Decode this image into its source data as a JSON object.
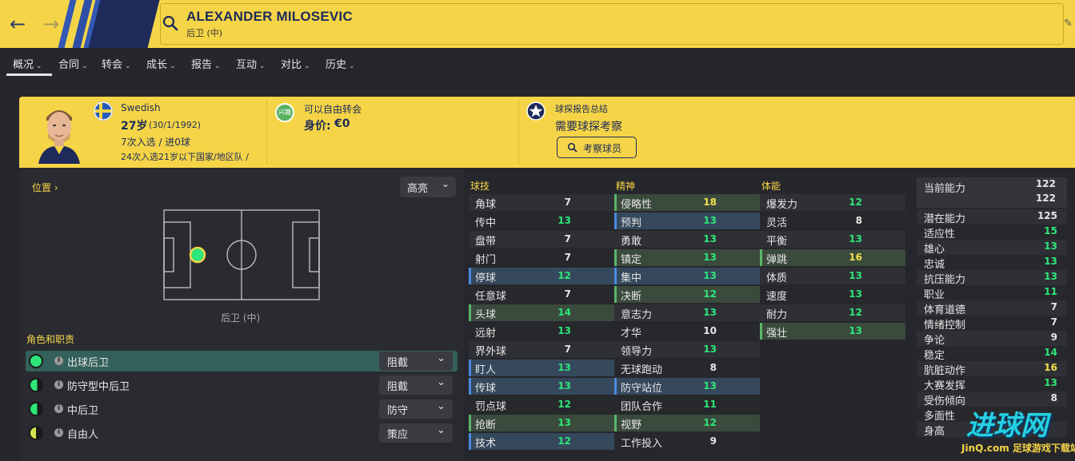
{
  "header": {
    "player_name": "ALEXANDER MILOSEVIC",
    "position": "后卫 (中)",
    "back_icon": "back-arrow-icon",
    "forward_icon": "forward-arrow-icon",
    "search_icon": "search-icon",
    "edit_icon": "pencil-icon"
  },
  "tabs": [
    {
      "label": "概况"
    },
    {
      "label": "合同"
    },
    {
      "label": "转会"
    },
    {
      "label": "成长"
    },
    {
      "label": "报告"
    },
    {
      "label": "互动"
    },
    {
      "label": "对比"
    },
    {
      "label": "历史"
    }
  ],
  "banner": {
    "nationality": "Swedish",
    "age": "27岁",
    "dob": "(30/1/1992)",
    "caps": "7次入选 / 进0球",
    "youth_caps": "24次入选21岁以下国家/地区队 /",
    "transfer_status": "可以自由转会",
    "interest_badge": "兴趣",
    "value_label": "身价:",
    "value": "€0",
    "scout_summary_title": "球探报告总结",
    "scout_summary": "需要球探考察",
    "scout_button": "考察球员"
  },
  "position_panel": {
    "title": "位置",
    "highlight_select": "高亮",
    "position_label": "后卫 (中)",
    "roles_title": "角色和职责",
    "roles": [
      {
        "name": "出球后卫",
        "duty": "阻截"
      },
      {
        "name": "防守型中后卫",
        "duty": "阻截"
      },
      {
        "name": "中后卫",
        "duty": "防守"
      },
      {
        "name": "自由人",
        "duty": "策应"
      }
    ]
  },
  "technical": {
    "title": "球技",
    "rows": [
      {
        "name": "角球",
        "value": "7"
      },
      {
        "name": "传中",
        "value": "13"
      },
      {
        "name": "盘带",
        "value": "7"
      },
      {
        "name": "射门",
        "value": "7"
      },
      {
        "name": "停球",
        "value": "12"
      },
      {
        "name": "任意球",
        "value": "7"
      },
      {
        "name": "头球",
        "value": "14"
      },
      {
        "name": "远射",
        "value": "13"
      },
      {
        "name": "界外球",
        "value": "7"
      },
      {
        "name": "盯人",
        "value": "13"
      },
      {
        "name": "传球",
        "value": "13"
      },
      {
        "name": "罚点球",
        "value": "12"
      },
      {
        "name": "抢断",
        "value": "13"
      },
      {
        "name": "技术",
        "value": "12"
      }
    ]
  },
  "mental": {
    "title": "精神",
    "rows": [
      {
        "name": "侵略性",
        "value": "18"
      },
      {
        "name": "预判",
        "value": "13"
      },
      {
        "name": "勇敢",
        "value": "13"
      },
      {
        "name": "镇定",
        "value": "13"
      },
      {
        "name": "集中",
        "value": "13"
      },
      {
        "name": "决断",
        "value": "12"
      },
      {
        "name": "意志力",
        "value": "13"
      },
      {
        "name": "才华",
        "value": "10"
      },
      {
        "name": "领导力",
        "value": "13"
      },
      {
        "name": "无球跑动",
        "value": "8"
      },
      {
        "name": "防守站位",
        "value": "13"
      },
      {
        "name": "团队合作",
        "value": "11"
      },
      {
        "name": "视野",
        "value": "12"
      },
      {
        "name": "工作投入",
        "value": "9"
      }
    ]
  },
  "physical": {
    "title": "体能",
    "rows": [
      {
        "name": "爆发力",
        "value": "12"
      },
      {
        "name": "灵活",
        "value": "8"
      },
      {
        "name": "平衡",
        "value": "13"
      },
      {
        "name": "弹跳",
        "value": "16"
      },
      {
        "name": "体质",
        "value": "13"
      },
      {
        "name": "速度",
        "value": "13"
      },
      {
        "name": "耐力",
        "value": "12"
      },
      {
        "name": "强壮",
        "value": "13"
      }
    ]
  },
  "hidden": {
    "ability_current_label": "当前能力",
    "ability_current_a": "122",
    "ability_current_b": "122",
    "rows": [
      {
        "name": "潜在能力",
        "value": "125"
      },
      {
        "name": "适应性",
        "value": "15"
      },
      {
        "name": "雄心",
        "value": "13"
      },
      {
        "name": "忠诚",
        "value": "13"
      },
      {
        "name": "抗压能力",
        "value": "13"
      },
      {
        "name": "职业",
        "value": "11"
      },
      {
        "name": "体育道德",
        "value": "7"
      },
      {
        "name": "情绪控制",
        "value": "7"
      },
      {
        "name": "争论",
        "value": "9"
      },
      {
        "name": "稳定",
        "value": "14"
      },
      {
        "name": "肮脏动作",
        "value": "16"
      },
      {
        "name": "大赛发挥",
        "value": "13"
      },
      {
        "name": "受伤倾向",
        "value": "8"
      },
      {
        "name": "多面性",
        "value": ""
      },
      {
        "name": "身高",
        "value": ""
      }
    ]
  },
  "watermark": {
    "big": "进球网",
    "small": "JinQ.com 足球游戏下载站"
  },
  "colors": {
    "accent": "#f5d547",
    "green": "#2ee67a",
    "yellow_val": "#f5e14d",
    "white_val": "#e6e6e6",
    "navy": "#1d2a5a"
  }
}
